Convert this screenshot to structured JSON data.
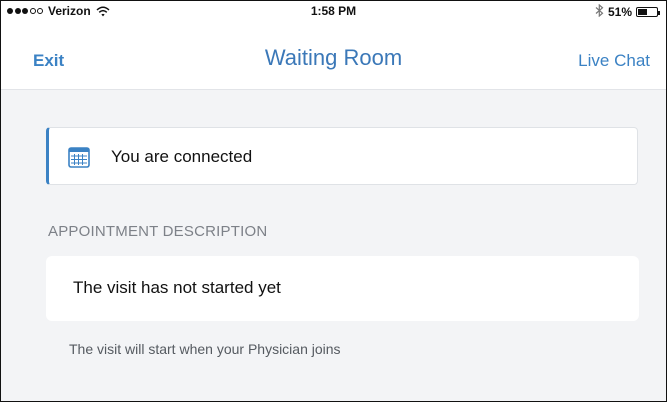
{
  "status_bar": {
    "carrier": "Verizon",
    "time": "1:58 PM",
    "battery_percent": "51%",
    "battery_level": 0.51,
    "signal_bars_filled": 3,
    "signal_bars_total": 5
  },
  "nav": {
    "exit_label": "Exit",
    "title": "Waiting Room",
    "chat_label": "Live Chat"
  },
  "connection": {
    "message": "You are connected",
    "icon": "calendar-icon"
  },
  "appointment": {
    "section_label": "APPOINTMENT DESCRIPTION",
    "status": "The visit has not started yet",
    "helper": "The visit will start when your Physician joins"
  },
  "colors": {
    "accent": "#3b82c4",
    "background": "#f3f4f6"
  }
}
